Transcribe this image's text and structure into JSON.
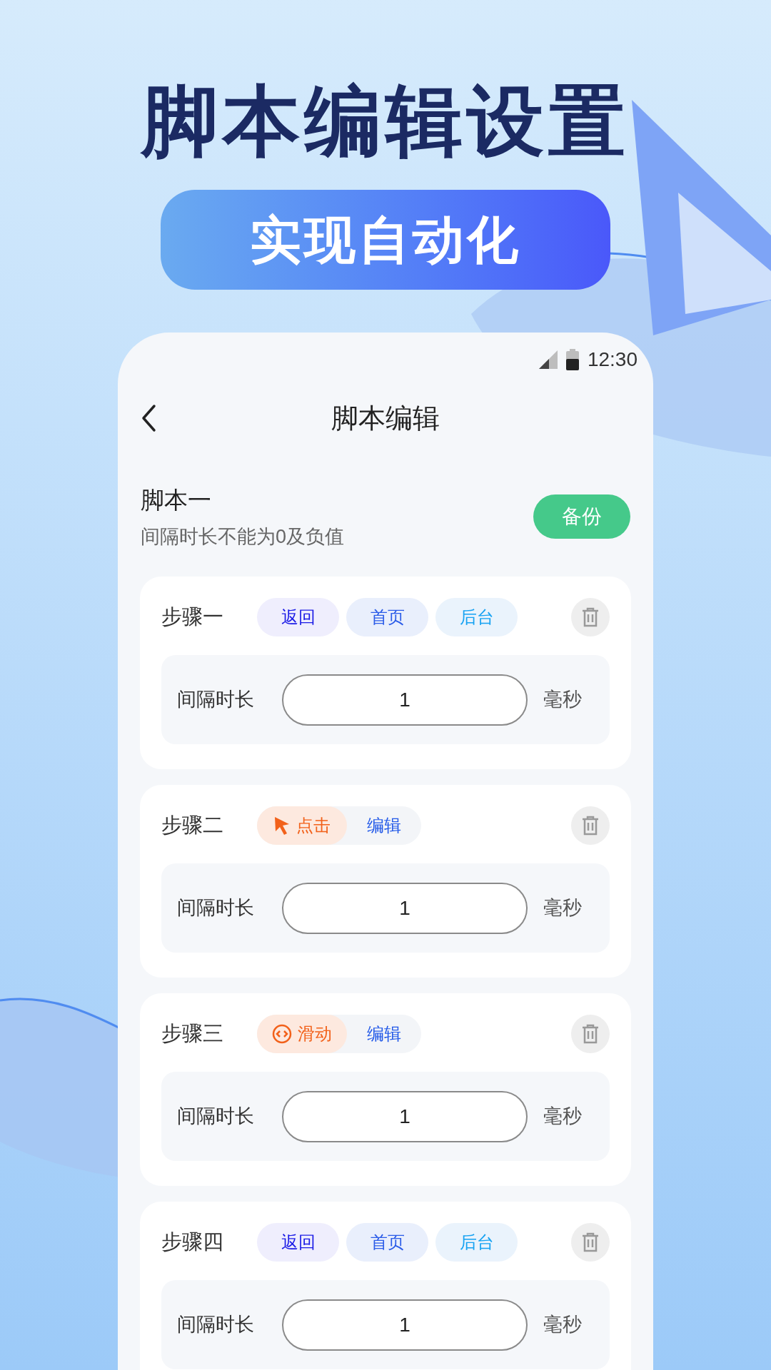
{
  "headline": "脚本编辑设置",
  "banner": "实现自动化",
  "status_bar": {
    "time": "12:30"
  },
  "header": {
    "title": "脚本编辑"
  },
  "script": {
    "name": "脚本一",
    "hint": "间隔时长不能为0及负值",
    "backup_button": "备份"
  },
  "steps": [
    {
      "label": "步骤一",
      "kind": "nav",
      "chips": [
        {
          "label": "返回",
          "color": "#1a1ae6"
        },
        {
          "label": "首页",
          "color": "#2b5ce8"
        },
        {
          "label": "后台",
          "color": "#16a2f2"
        }
      ],
      "interval_label": "间隔时长",
      "value": "1",
      "unit": "毫秒"
    },
    {
      "label": "步骤二",
      "kind": "action",
      "action": {
        "label": "点击",
        "kind": "tap"
      },
      "edit": "编辑",
      "interval_label": "间隔时长",
      "value": "1",
      "unit": "毫秒"
    },
    {
      "label": "步骤三",
      "kind": "action",
      "action": {
        "label": "滑动",
        "kind": "swipe"
      },
      "edit": "编辑",
      "interval_label": "间隔时长",
      "value": "1",
      "unit": "毫秒"
    },
    {
      "label": "步骤四",
      "kind": "nav",
      "chips": [
        {
          "label": "返回",
          "color": "#1a1ae6"
        },
        {
          "label": "首页",
          "color": "#2b5ce8"
        },
        {
          "label": "后台",
          "color": "#16a2f2"
        }
      ],
      "interval_label": "间隔时长",
      "value": "1",
      "unit": "毫秒"
    }
  ]
}
